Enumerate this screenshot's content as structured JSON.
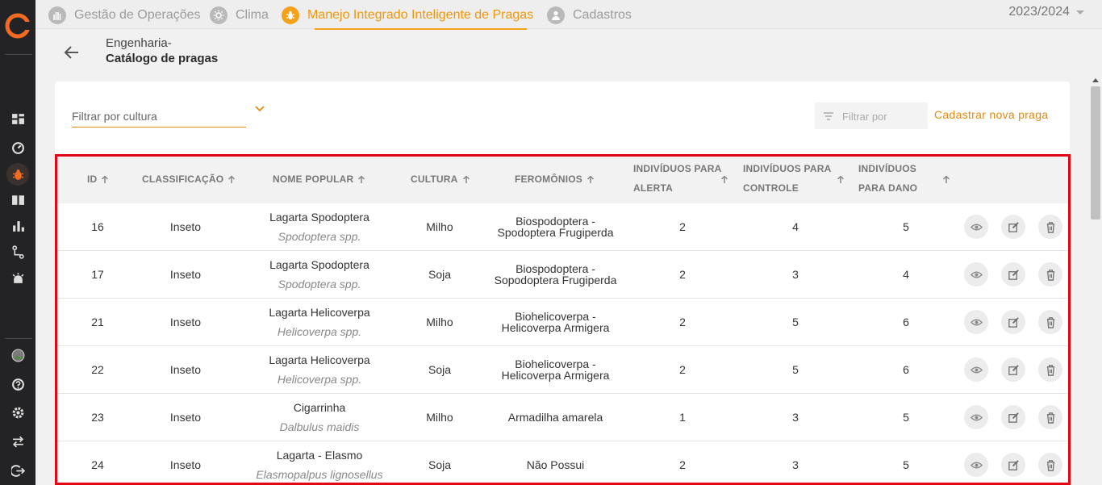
{
  "nav": {
    "tabs": [
      {
        "label": "Gestão de Operações",
        "icon": "hand-icon"
      },
      {
        "label": "Clima",
        "icon": "sun-icon"
      },
      {
        "label": "Manejo Integrado Inteligente de Pragas",
        "icon": "bug-icon",
        "active": true
      },
      {
        "label": "Cadastros",
        "icon": "person-icon"
      }
    ],
    "season": "2023/2024"
  },
  "sidebar": {
    "icons": [
      "dashboard-icon",
      "gauge-icon",
      "bug-icon",
      "book-icon",
      "bar-chart-icon",
      "route-icon",
      "alarm-icon",
      "avatar",
      "help-icon",
      "settings-icon",
      "swap-icon",
      "logout-icon"
    ],
    "active": "bug-icon",
    "accent": "#f26b21"
  },
  "header": {
    "crumb_parent": "Engenharia-",
    "crumb_current": "Catálogo de pragas"
  },
  "toolbar": {
    "culture_filter_label": "Filtrar por cultura",
    "filter_placeholder": "Filtrar por",
    "new_button": "Cadastrar nova praga",
    "accent": "#e38a12"
  },
  "table": {
    "columns": {
      "id": "ID",
      "classification": "CLASSIFICAÇÃO",
      "popular_name": "NOME POPULAR",
      "culture": "CULTURA",
      "pheromones": "FEROMÔNIOS",
      "alert_1": "INDIVÍDUOS PARA",
      "alert_2": "ALERTA",
      "control_1": "INDIVÍDUOS PARA",
      "control_2": "CONTROLE",
      "damage_1": "INDIVÍDUOS",
      "damage_2": "PARA DANO"
    },
    "rows": [
      {
        "id": "16",
        "classification": "Inseto",
        "name": "Lagarta Spodoptera",
        "scientific": "Spodoptera spp.",
        "culture": "Milho",
        "pheromone_1": "Biospodoptera -",
        "pheromone_2": "Spodoptera Frugiperda",
        "alert": "2",
        "control": "4",
        "damage": "5"
      },
      {
        "id": "17",
        "classification": "Inseto",
        "name": "Lagarta Spodoptera",
        "scientific": "Spodoptera spp.",
        "culture": "Soja",
        "pheromone_1": "Biospodoptera -",
        "pheromone_2": "Sopodoptera Frugiperda",
        "alert": "2",
        "control": "3",
        "damage": "4"
      },
      {
        "id": "21",
        "classification": "Inseto",
        "name": "Lagarta Helicoverpa",
        "scientific": "Helicoverpa spp.",
        "culture": "Milho",
        "pheromone_1": "Biohelicoverpa -",
        "pheromone_2": "Helicoverpa Armigera",
        "alert": "2",
        "control": "5",
        "damage": "6"
      },
      {
        "id": "22",
        "classification": "Inseto",
        "name": "Lagarta Helicoverpa",
        "scientific": "Helicoverpa spp.",
        "culture": "Soja",
        "pheromone_1": "Biohelicoverpa -",
        "pheromone_2": "Helicoverpa Armigera",
        "alert": "2",
        "control": "5",
        "damage": "6"
      },
      {
        "id": "23",
        "classification": "Inseto",
        "name": "Cigarrinha",
        "scientific": "Dalbulus maidis",
        "culture": "Milho",
        "pheromone_1": "Armadilha amarela",
        "pheromone_2": "",
        "alert": "1",
        "control": "3",
        "damage": "5"
      },
      {
        "id": "24",
        "classification": "Inseto",
        "name": "Lagarta - Elasmo",
        "scientific": "Elasmopalpus lignosellus",
        "culture": "Soja",
        "pheromone_1": "Não Possui",
        "pheromone_2": "",
        "alert": "2",
        "control": "3",
        "damage": "5"
      }
    ]
  }
}
